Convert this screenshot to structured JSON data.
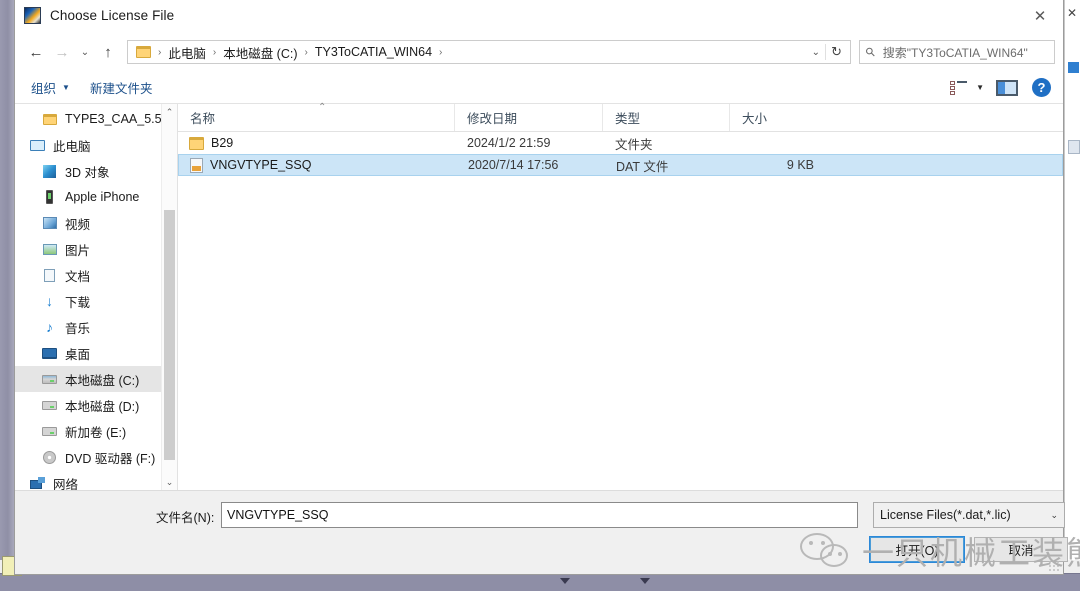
{
  "window": {
    "title": "Choose License File",
    "app_icon": "app-gradient-icon",
    "close_label": "✕"
  },
  "navbar": {
    "back_label": "←",
    "forward_label": "→",
    "recent_label": "⌄",
    "up_label": "↑",
    "breadcrumbs": [
      "此电脑",
      "本地磁盘 (C:)",
      "TY3ToCATIA_WIN64"
    ],
    "separator": "›",
    "dropdown_label": "⌄",
    "refresh_label": "↻"
  },
  "search": {
    "placeholder": "搜索\"TY3ToCATIA_WIN64\"",
    "icon": "search-icon"
  },
  "toolbar": {
    "organize_label": "组织",
    "organize_caret": "▼",
    "new_folder_label": "新建文件夹",
    "view_caret": "▼",
    "help_label": "?"
  },
  "sidebar": {
    "items": [
      {
        "label": "TYPE3_CAA_5.5",
        "icon": "folder-icon",
        "icon_class": "ico-folder",
        "selected": false,
        "indent": 26
      },
      {
        "label": "此电脑",
        "icon": "computer-icon",
        "icon_class": "ico-pc",
        "selected": false,
        "indent": 14
      },
      {
        "label": "3D 对象",
        "icon": "3d-objects-icon",
        "icon_class": "ico-3d",
        "selected": false,
        "indent": 26
      },
      {
        "label": "Apple iPhone",
        "icon": "phone-icon",
        "icon_class": "ico-phone",
        "selected": false,
        "indent": 26
      },
      {
        "label": "视频",
        "icon": "videos-icon",
        "icon_class": "ico-video",
        "selected": false,
        "indent": 26
      },
      {
        "label": "图片",
        "icon": "pictures-icon",
        "icon_class": "ico-pic",
        "selected": false,
        "indent": 26
      },
      {
        "label": "文档",
        "icon": "documents-icon",
        "icon_class": "ico-doc",
        "selected": false,
        "indent": 26
      },
      {
        "label": "下载",
        "icon": "downloads-icon",
        "icon_class": "ico-dl",
        "selected": false,
        "indent": 26,
        "glyph": "↓"
      },
      {
        "label": "音乐",
        "icon": "music-icon",
        "icon_class": "ico-music",
        "selected": false,
        "indent": 26,
        "glyph": "♪"
      },
      {
        "label": "桌面",
        "icon": "desktop-icon",
        "icon_class": "ico-desk",
        "selected": false,
        "indent": 26
      },
      {
        "label": "本地磁盘 (C:)",
        "icon": "drive-c-icon",
        "icon_class": "ico-drive sys",
        "selected": true,
        "indent": 26
      },
      {
        "label": "本地磁盘 (D:)",
        "icon": "drive-d-icon",
        "icon_class": "ico-drive",
        "selected": false,
        "indent": 26
      },
      {
        "label": "新加卷 (E:)",
        "icon": "drive-e-icon",
        "icon_class": "ico-drive",
        "selected": false,
        "indent": 26
      },
      {
        "label": "DVD 驱动器 (F:)",
        "icon": "dvd-drive-icon",
        "icon_class": "ico-dvd",
        "selected": false,
        "indent": 26
      },
      {
        "label": "网络",
        "icon": "network-icon",
        "icon_class": "ico-net",
        "selected": false,
        "indent": 14
      }
    ],
    "scroll_up_label": "⌃",
    "scroll_down_label": "⌄"
  },
  "filelist": {
    "columns": [
      {
        "label": "名称",
        "key": "name"
      },
      {
        "label": "修改日期",
        "key": "date"
      },
      {
        "label": "类型",
        "key": "type"
      },
      {
        "label": "大小",
        "key": "size"
      }
    ],
    "sort_indicator": "⌃",
    "rows": [
      {
        "name": "B29",
        "date": "2024/1/2 21:59",
        "type": "文件夹",
        "size": "",
        "icon": "folder-icon",
        "icon_class": "folder",
        "selected": false
      },
      {
        "name": "VNGVTYPE_SSQ",
        "date": "2020/7/14 17:56",
        "type": "DAT 文件",
        "size": "9 KB",
        "icon": "dat-file-icon",
        "icon_class": "dat",
        "selected": true
      }
    ]
  },
  "footer": {
    "filename_label": "文件名(N):",
    "filename_value": "VNGVTYPE_SSQ",
    "filetype_value": "License Files(*.dat,*.lic)",
    "filetype_caret": "⌄",
    "open_label": "打开(O)",
    "cancel_label": "取消"
  },
  "watermark": {
    "text": "一只机械工装熊",
    "logo": "wechat-logo"
  },
  "colors": {
    "selection_bg": "#cce5f7",
    "selection_border": "#a8d2ee",
    "sidebar_selected_bg": "#e5e5e5",
    "accent_blue": "#1f6fc4",
    "focus_border": "#2b88d8",
    "toolbar_link": "#1b4f8a",
    "desktop_bg": "#8b8ba3"
  }
}
